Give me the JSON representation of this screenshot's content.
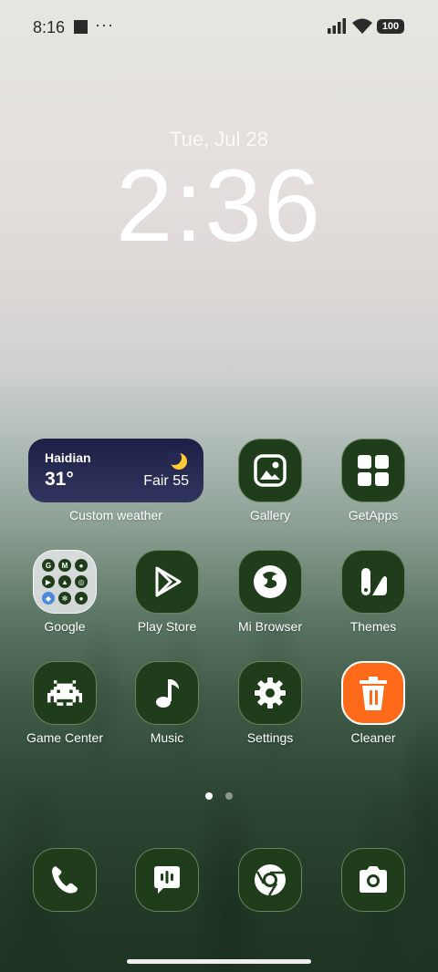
{
  "status_bar": {
    "time": "8:16",
    "more": "···",
    "battery": "100"
  },
  "lockscreen": {
    "date": "Tue, Jul 28",
    "time": "2:36"
  },
  "weather_widget": {
    "city": "Haidian",
    "temperature": "31°",
    "condition": "Fair 55",
    "label": "Custom weather"
  },
  "apps": {
    "gallery": "Gallery",
    "getapps": "GetApps",
    "google": "Google",
    "play_store": "Play Store",
    "mi_browser": "Mi Browser",
    "themes": "Themes",
    "game_center": "Game Center",
    "music": "Music",
    "settings": "Settings",
    "cleaner": "Cleaner"
  },
  "google_folder_icons": [
    "G",
    "M",
    "mic",
    "yt",
    "drive",
    "lens",
    "photos",
    "pinwheel",
    "account"
  ],
  "page_indicator": {
    "pages": 2,
    "active": 0
  },
  "dock": [
    "phone-icon",
    "messages-icon",
    "chrome-icon",
    "camera-icon"
  ],
  "colors": {
    "icon_bg": "#1f3d1a",
    "cleaner_bg": "#ff6a1a",
    "weather_bg": "#1d1f45"
  }
}
